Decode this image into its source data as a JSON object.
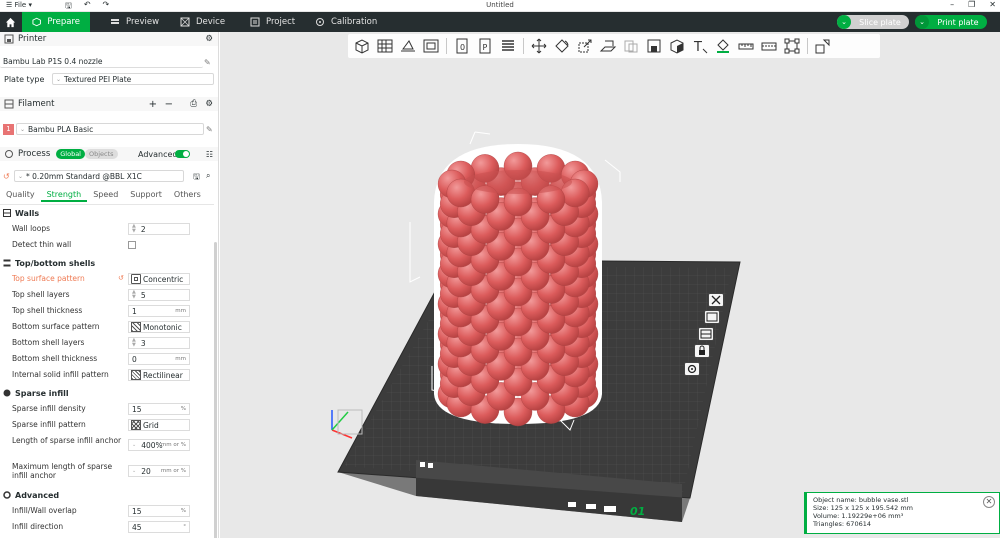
{
  "titlebar": {
    "file_menu": "File",
    "title": "Untitled"
  },
  "tabs": {
    "prepare": "Prepare",
    "preview": "Preview",
    "device": "Device",
    "project": "Project",
    "calibration": "Calibration"
  },
  "actions": {
    "slice": "Slice plate",
    "print": "Print plate"
  },
  "printer": {
    "section": "Printer",
    "name": "Bambu Lab P1S 0.4 nozzle",
    "plate_label": "Plate type",
    "plate_value": "Textured PEI Plate"
  },
  "filament": {
    "section": "Filament",
    "slot_number": "1",
    "slot_color": "#e87474",
    "name": "Bambu PLA Basic"
  },
  "process": {
    "section": "Process",
    "global": "Global",
    "objects": "Objects",
    "advanced": "Advanced",
    "preset": "* 0.20mm Standard @BBL X1C"
  },
  "param_tabs": [
    "Quality",
    "Strength",
    "Speed",
    "Support",
    "Others"
  ],
  "groups": {
    "walls": "Walls",
    "topbottom": "Top/bottom shells",
    "sparse": "Sparse infill",
    "advanced": "Advanced"
  },
  "params": {
    "wall_loops": {
      "label": "Wall loops",
      "value": "2"
    },
    "detect_thin": {
      "label": "Detect thin wall"
    },
    "top_pattern": {
      "label": "Top surface pattern",
      "value": "Concentric"
    },
    "top_layers": {
      "label": "Top shell layers",
      "value": "5"
    },
    "top_thickness": {
      "label": "Top shell thickness",
      "value": "1",
      "unit": "mm"
    },
    "bottom_pattern": {
      "label": "Bottom surface pattern",
      "value": "Monotonic"
    },
    "bottom_layers": {
      "label": "Bottom shell layers",
      "value": "3"
    },
    "bottom_thickness": {
      "label": "Bottom shell thickness",
      "value": "0",
      "unit": "mm"
    },
    "internal_pattern": {
      "label": "Internal solid infill pattern",
      "value": "Rectilinear"
    },
    "sparse_density": {
      "label": "Sparse infill density",
      "value": "15",
      "unit": "%"
    },
    "sparse_pattern": {
      "label": "Sparse infill pattern",
      "value": "Grid"
    },
    "anchor_len": {
      "label": "Length of sparse infill anchor",
      "value": "400%",
      "unit": "mm or %"
    },
    "anchor_max": {
      "label": "Maximum length of sparse infill anchor",
      "value": "20",
      "unit": "mm or %"
    },
    "overlap": {
      "label": "Infill/Wall overlap",
      "value": "15",
      "unit": "%"
    },
    "direction": {
      "label": "Infill direction",
      "value": "45",
      "unit": "°"
    }
  },
  "plate_number": "01",
  "object_info": {
    "name": "Object name: bubble vase.stl",
    "size": "Size: 125 x 125 x 195.542 mm",
    "volume": "Volume: 1.19229e+06 mm³",
    "triangles": "Triangles: 670614"
  },
  "colors": {
    "accent": "#00ae42",
    "dark": "#262e30",
    "model": "#e06868",
    "plate": "#3a3a3a"
  }
}
